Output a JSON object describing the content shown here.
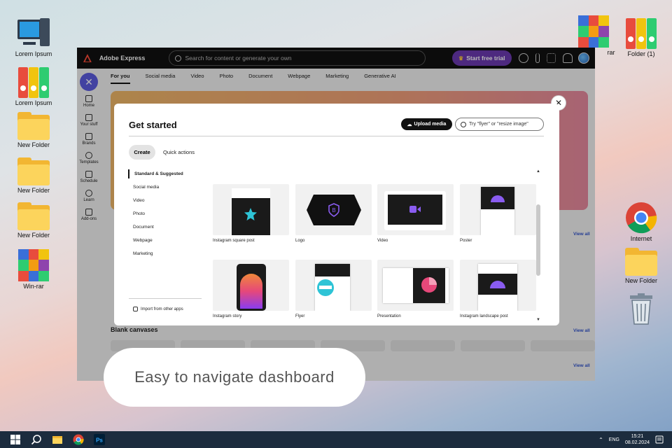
{
  "desktop": {
    "icons_left": [
      {
        "label": "Lorem Ipsum",
        "kind": "pc-icon"
      },
      {
        "label": "Lorem Ipsum",
        "kind": "binders-icon"
      },
      {
        "label": "New Folder",
        "kind": "folder-icon"
      },
      {
        "label": "New Folder",
        "kind": "folder-icon"
      },
      {
        "label": "New Folder",
        "kind": "folder-icon"
      },
      {
        "label": "Win-rar",
        "kind": "winrar-icon"
      }
    ],
    "icons_right": [
      {
        "label": "rar",
        "kind": "winrar-icon"
      },
      {
        "label": "Folder (1)",
        "kind": "binders-icon"
      },
      {
        "label": "Internet",
        "kind": "chrome-icon"
      },
      {
        "label": "New Folder",
        "kind": "folder-icon"
      },
      {
        "label": "",
        "kind": "recycle-bin-icon"
      }
    ]
  },
  "app": {
    "title": "Adobe Express",
    "search_placeholder": "Search for content or generate your own",
    "trial_label": "Start free trial",
    "left_nav": [
      {
        "label": "Home"
      },
      {
        "label": "Your stuff"
      },
      {
        "label": "Brands"
      },
      {
        "label": "Templates"
      },
      {
        "label": "Schedule"
      },
      {
        "label": "Learn"
      },
      {
        "label": "Add-ons"
      }
    ],
    "tabs": [
      "For you",
      "Social media",
      "Video",
      "Photo",
      "Document",
      "Webpage",
      "Marketing",
      "Generative AI"
    ],
    "view_all": "View all",
    "blank_canvases": "Blank canvases"
  },
  "modal": {
    "title": "Get started",
    "upload_label": "Upload media",
    "search_placeholder": "Try \"flyer\" or \"resize image\"",
    "pill_create": "Create",
    "pill_quick_actions": "Quick actions",
    "categories": [
      "Standard & Suggested",
      "Social media",
      "Video",
      "Photo",
      "Document",
      "Webpage",
      "Marketing"
    ],
    "import_label": "Import from other apps",
    "cards": [
      {
        "label": "Instagram square post"
      },
      {
        "label": "Logo"
      },
      {
        "label": "Video"
      },
      {
        "label": "Poster"
      },
      {
        "label": "Instagram story"
      },
      {
        "label": "Flyer"
      },
      {
        "label": "Presentation"
      },
      {
        "label": "Instagram landscape post"
      }
    ]
  },
  "caption": "Easy to navigate dashboard",
  "taskbar": {
    "lang": "ENG",
    "time": "15:21",
    "date": "08.02.2024"
  },
  "colors": {
    "accent": "#5c5ce0",
    "trial": "#6b3ab0",
    "taskbar": "#1c2c3e"
  }
}
